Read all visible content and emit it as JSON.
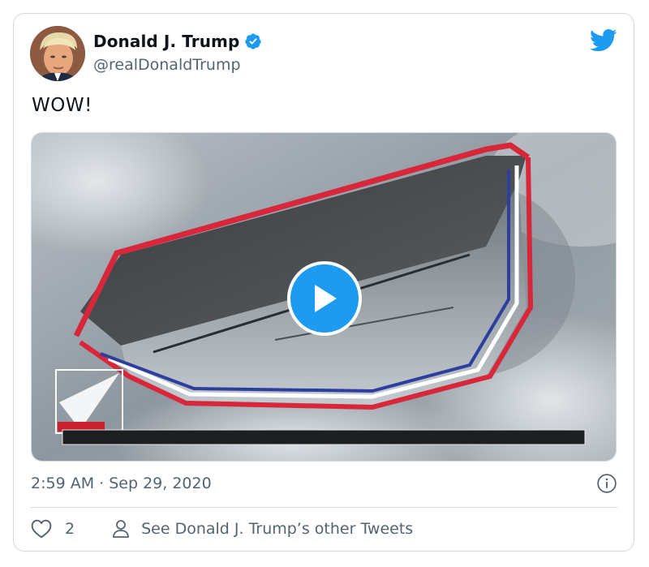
{
  "author": {
    "name": "Donald J. Trump",
    "handle": "@realDonaldTrump",
    "verified": true
  },
  "tweet": {
    "text": "WOW!",
    "timestamp": "2:59 AM · Sep 29, 2020"
  },
  "actions": {
    "like_count": "2",
    "profile_link": "See Donald J. Trump’s other Tweets"
  },
  "icons": {
    "brand": "twitter-bird-icon",
    "verified": "verified-badge-icon",
    "play": "play-icon",
    "info": "info-icon",
    "like": "heart-icon",
    "profile": "person-icon"
  },
  "colors": {
    "accent": "#1d9bf0",
    "text": "#0f1419",
    "secondary_text": "#536471",
    "border": "#cfd9de"
  }
}
